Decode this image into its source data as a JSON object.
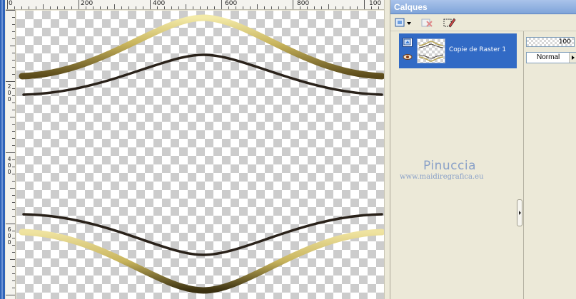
{
  "ruler": {
    "top_labels": [
      "0",
      "200",
      "400",
      "600",
      "800",
      "100"
    ],
    "left_labels": [
      "2",
      "0",
      "0",
      "4",
      "0",
      "0",
      "6",
      "0",
      "0"
    ]
  },
  "canvas": {
    "content": "two decorative wave curves (gold and dark) mirrored top and bottom on transparent background"
  },
  "palette": {
    "title": "Calques",
    "layer": {
      "name": "Copie de Raster 1"
    },
    "opacity": "100",
    "blend_mode": "Normal"
  },
  "watermark": {
    "name": "Pinuccia",
    "url": "www.maidiregrafica.eu"
  },
  "colors": {
    "gold": "#c8b45c",
    "dark_line": "#2a221a",
    "selection": "#316ac5",
    "title_bar": "#7fa4d9"
  },
  "icons": {
    "new_layer": "layer-stack-icon",
    "delete": "delete-layer-icon",
    "edit": "edit-pen-icon",
    "visibility": "eye-icon",
    "layer_type": "raster-layer-icon"
  }
}
